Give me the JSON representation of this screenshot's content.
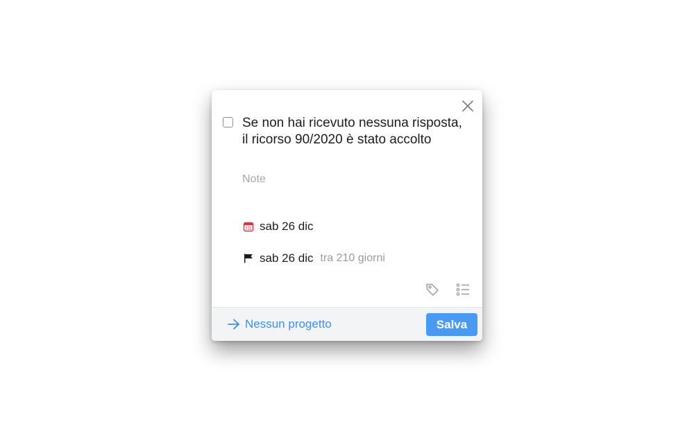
{
  "task": {
    "title": "Se non hai ricevuto nessuna risposta, il ricorso 90/2020 è stato accolto",
    "notes_placeholder": "Note"
  },
  "when": {
    "label": "sab 26 dic",
    "icon": "calendar-icon",
    "icon_color": "#e5303a"
  },
  "deadline": {
    "label": "sab 26 dic",
    "relative": "tra 210 giorni",
    "icon": "flag-icon"
  },
  "toolbar": {
    "tag_icon": "tag-icon",
    "checklist_icon": "checklist-icon"
  },
  "footer": {
    "project_label": "Nessun progetto",
    "save_label": "Salva"
  },
  "colors": {
    "accent": "#4a9af1",
    "link": "#3d8ee8",
    "calendar_red": "#e5303a"
  }
}
